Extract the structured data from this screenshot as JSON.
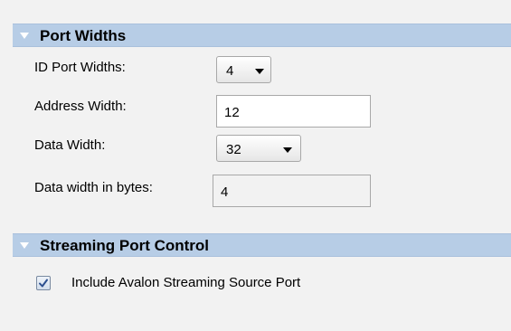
{
  "port_widths": {
    "header": "Port Widths",
    "id_port_widths": {
      "label": "ID Port Widths:",
      "value": "4"
    },
    "address_width": {
      "label": "Address Width:",
      "value": "12"
    },
    "data_width": {
      "label": "Data Width:",
      "value": "32"
    },
    "data_width_bytes": {
      "label": "Data width in bytes:",
      "value": "4"
    }
  },
  "streaming_port_control": {
    "header": "Streaming Port Control",
    "include_source": {
      "label": "Include Avalon Streaming Source Port",
      "checked": true
    }
  },
  "colors": {
    "header_bg": "#b7cde6",
    "panel_bg": "#f2f2f2",
    "check_color": "#2c4f8f"
  },
  "icons": {
    "collapse": "triangle-down-icon",
    "dropdown": "chevron-down-icon",
    "check": "checkmark-icon"
  }
}
